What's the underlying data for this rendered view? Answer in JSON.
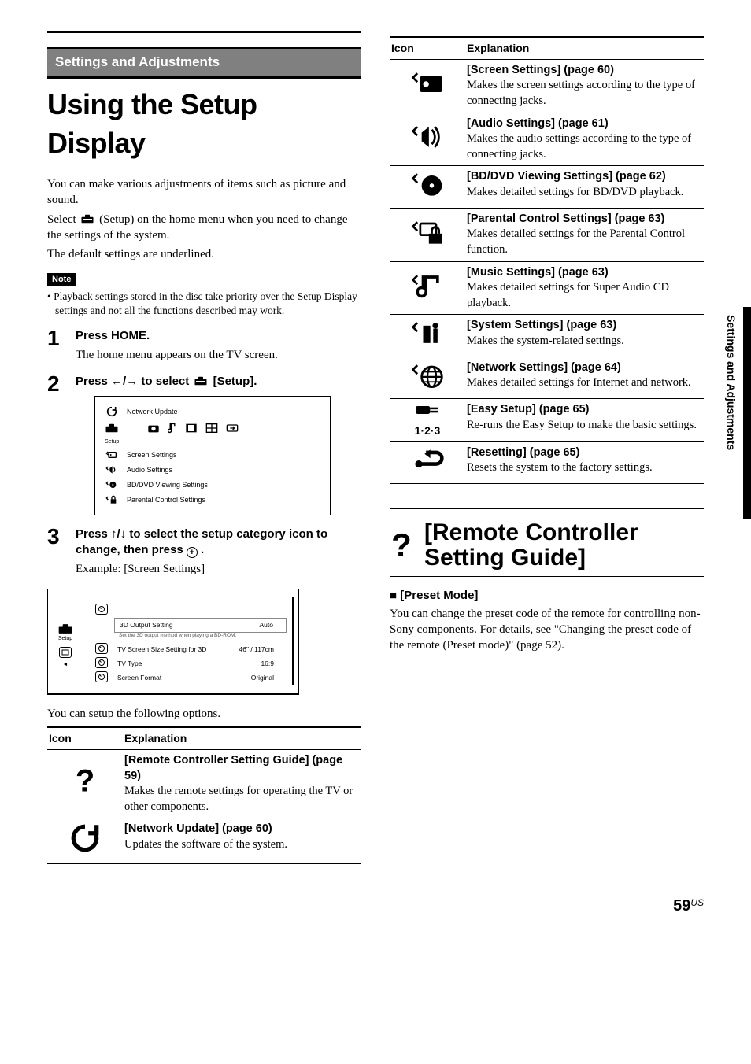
{
  "section_banner": "Settings and Adjustments",
  "main_title": "Using the Setup Display",
  "intro1": "You can make various adjustments of items such as picture and sound.",
  "intro2a": "Select ",
  "intro2b": " (Setup) on the home menu when you need to change the settings of the system.",
  "intro3": "The default settings are underlined.",
  "note_label": "Note",
  "note_text": "• Playback settings stored in the disc take priority over the Setup Display settings and not all the functions described may work.",
  "step1": {
    "head": "Press HOME.",
    "sub": "The home menu appears on the TV screen."
  },
  "step2": {
    "head_pre": "Press ",
    "head_keys": "←/→",
    "head_mid": " to select ",
    "head_post": " [Setup]."
  },
  "ss1": {
    "network_update": "Network Update",
    "setup": "Setup",
    "items": [
      "Screen Settings",
      "Audio Settings",
      "BD/DVD Viewing Settings",
      "Parental Control Settings"
    ]
  },
  "step3": {
    "head_pre": "Press ",
    "head_keys": "↑/↓",
    "head_mid": " to select the setup category icon to change, then press ",
    "head_post": " .",
    "example": "Example: [Screen Settings]"
  },
  "ss2": {
    "setup": "Setup",
    "rows": [
      {
        "label": "3D Output Setting",
        "value": "Auto",
        "sub": "Set the 3D output method when playing a BD-ROM."
      },
      {
        "label": "TV Screen Size Setting for 3D",
        "value": "46\" / 117cm"
      },
      {
        "label": "TV Type",
        "value": "16:9"
      },
      {
        "label": "Screen Format",
        "value": "Original"
      }
    ]
  },
  "options_intro": "You can setup the following options.",
  "table_headers": {
    "icon": "Icon",
    "explanation": "Explanation"
  },
  "left_rows": [
    {
      "title": "[Remote Controller Setting Guide] (page 59)",
      "desc": "Makes the remote settings for operating the TV or other components."
    },
    {
      "title": "[Network Update] (page 60)",
      "desc": "Updates the software of the system."
    }
  ],
  "right_rows": [
    {
      "title": "[Screen Settings] (page 60)",
      "desc": "Makes the screen settings according to the type of connecting jacks."
    },
    {
      "title": "[Audio Settings] (page 61)",
      "desc": "Makes the audio settings according to the type of connecting jacks."
    },
    {
      "title": "[BD/DVD Viewing Settings] (page 62)",
      "desc": "Makes detailed settings for BD/DVD playback."
    },
    {
      "title": "[Parental Control Settings] (page 63)",
      "desc": "Makes detailed settings for the Parental Control function."
    },
    {
      "title": "[Music Settings] (page 63)",
      "desc": "Makes detailed settings for Super Audio CD playback."
    },
    {
      "title": "[System Settings] (page 63)",
      "desc": "Makes the system-related settings."
    },
    {
      "title": "[Network Settings] (page 64)",
      "desc": "Makes detailed settings for Internet and network."
    },
    {
      "title": "[Easy Setup] (page 65)",
      "desc": "Re-runs the Easy Setup to make the basic settings."
    },
    {
      "title": "[Resetting] (page 65)",
      "desc": "Resets the system to the factory settings."
    }
  ],
  "easy_setup_icon_text": "1·2·3",
  "section2_title": "[Remote Controller Setting Guide]",
  "preset_head": "[Preset Mode]",
  "preset_body": "You can change the preset code of the remote for controlling non-Sony components. For details, see \"Changing the preset code of the remote (Preset mode)\" (page 52).",
  "side_label": "Settings and Adjustments",
  "page_number": "59",
  "page_suffix": "US"
}
